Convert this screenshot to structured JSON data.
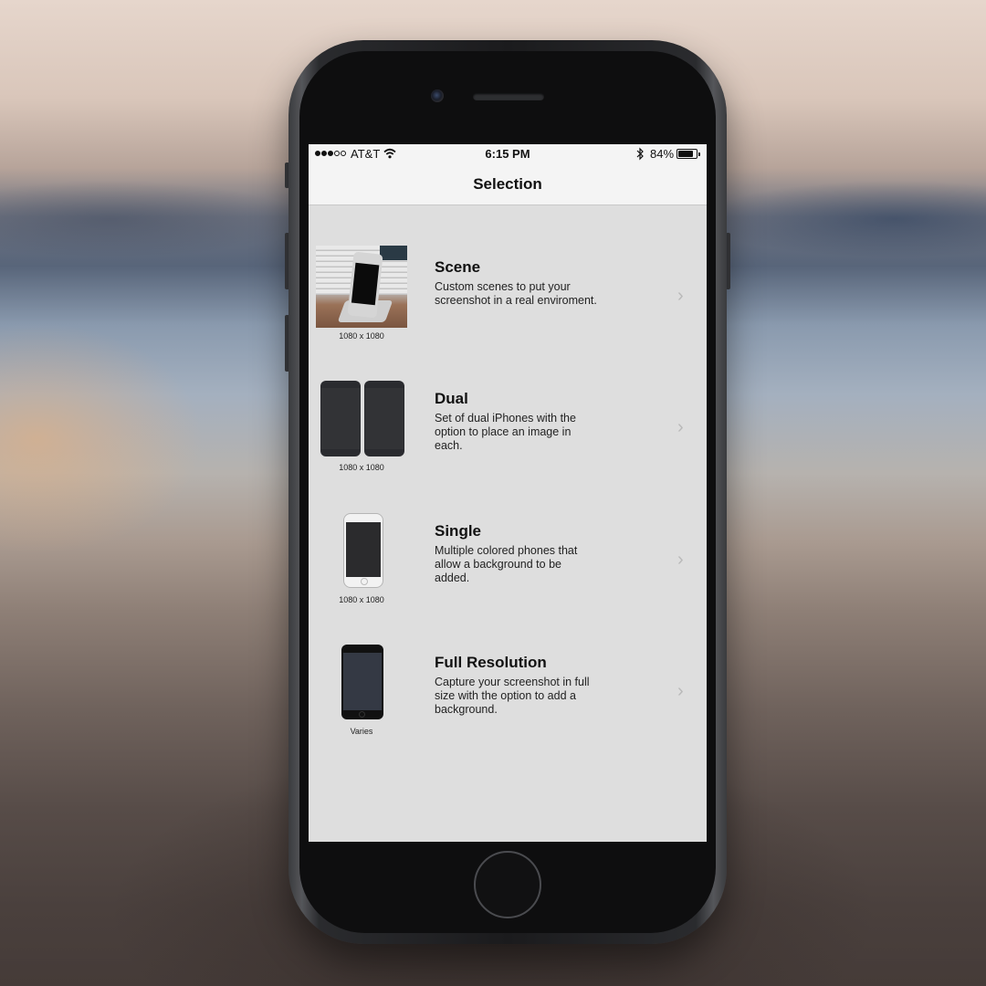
{
  "status_bar": {
    "carrier": "AT&T",
    "time": "6:15 PM",
    "battery_percent": "84%",
    "battery_level": 0.84,
    "signal_bars_filled": 3,
    "signal_bars_total": 5
  },
  "nav": {
    "title": "Selection"
  },
  "rows": [
    {
      "title": "Scene",
      "description": "Custom scenes to put your screenshot in a real enviroment.",
      "caption": "1080 x 1080",
      "icon": "scene-thumbnail"
    },
    {
      "title": "Dual",
      "description": "Set of dual iPhones with the option to place an image in each.",
      "caption": "1080 x 1080",
      "icon": "dual-phone-thumbnail"
    },
    {
      "title": "Single",
      "description": "Multiple colored phones that allow a background to be added.",
      "caption": "1080 x 1080",
      "icon": "single-phone-thumbnail"
    },
    {
      "title": "Full Resolution",
      "description": "Capture your screenshot in full size with the option to add a background.",
      "caption": "Varies",
      "icon": "full-resolution-thumbnail"
    }
  ],
  "colors": {
    "screen_background": "#dedede",
    "bar_background": "#f4f4f4",
    "chevron": "#b9b9b9"
  }
}
